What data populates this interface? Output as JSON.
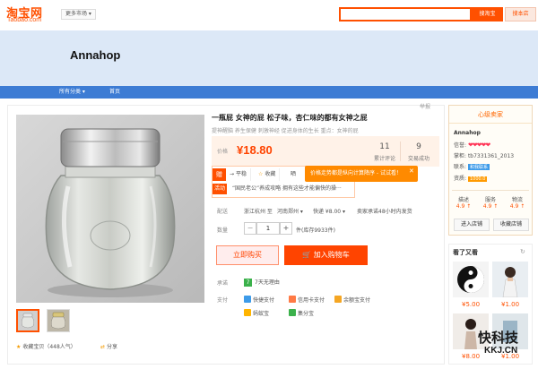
{
  "header": {
    "logo_cn": "淘宝网",
    "logo_en": "Taobao.com",
    "market_select": "更多市场 ▾",
    "search_button": "搜淘宝",
    "search_shop_button": "搜本店",
    "accent_color": "#ff5000"
  },
  "shop": {
    "name": "Annahop",
    "banner_color": "#dce8f7"
  },
  "nav": {
    "all_categories": "所有分类 ▾",
    "home": "首页",
    "bar_color": "#3d7cd4"
  },
  "item": {
    "report": "举报",
    "title": "一瓶屁 女神的屁 松子味，杏仁味的都有女神之屁",
    "subtitle": "提神醒脑 养生保健 刺激神经 促进身体的生长 重点：女神的屁",
    "price_label": "价格",
    "price": "¥18.80",
    "reviews_count": "11",
    "reviews_label": "累计评论",
    "deals_count": "9",
    "deals_label": "交易成功",
    "promo_badge": "赠",
    "actions": [
      "平稳",
      "收藏",
      "晒"
    ],
    "tooltip": "价格走势都是纵向计算降序 - 试试看！",
    "tooltip_close": "✕",
    "promo_tag": "活动",
    "promo_text": "“国民老公”养成攻略 拥有这些才能偏快的操···",
    "delivery_label": "配送",
    "delivery_from": "浙江杭州 至",
    "delivery_to": "河南郑州 ▾",
    "shipping": "快递 ¥8.00 ▾",
    "ship_promise": "卖家承诺48小时内发货",
    "qty_label": "数量",
    "qty_minus": "−",
    "qty_value": "1",
    "qty_plus": "+",
    "stock": "件(库存9933件)",
    "buy_now": "立即购买",
    "add_to_cart": "加入购物车",
    "promise_label": "承诺",
    "promise_badge": "7",
    "promise_text": "7天无理由",
    "pay_label": "支付",
    "pay_methods": [
      {
        "name": "快捷支付",
        "color": "#3d9be9"
      },
      {
        "name": "信用卡支付",
        "color": "#ff7a45"
      },
      {
        "name": "余额宝支付",
        "color": "#f5a623"
      },
      {
        "name": "蚂蚁宝",
        "color": "#ffb400"
      },
      {
        "name": "集分宝",
        "color": "#3bb14b"
      }
    ],
    "fav_label": "收藏宝贝（448人气）",
    "share_label": "分享"
  },
  "seller": {
    "header": "心级卖家",
    "name": "Annahop",
    "credit_label": "信誉:",
    "credit_hearts": "❤❤❤❤❤",
    "wangwang_label": "掌柜:",
    "wangwang": "tb7331361_2013",
    "contact_label": "联系:",
    "contact_badge": "和我联系",
    "qualification_label": "资质:",
    "deposit_badge": "1000.0",
    "scores": [
      {
        "label": "描述",
        "value": "4.9 ↑"
      },
      {
        "label": "服务",
        "value": "4.9 ↑"
      },
      {
        "label": "物流",
        "value": "4.9 ↑"
      }
    ],
    "enter_shop": "进入店铺",
    "favorite_shop": "收藏店铺"
  },
  "recent": {
    "title": "看了又看",
    "refresh": "↻",
    "items": [
      {
        "price": "¥5.00"
      },
      {
        "price": "¥1.00"
      },
      {
        "price": "¥8.00"
      },
      {
        "price": "¥1.00"
      }
    ]
  },
  "watermark": {
    "brand": "快科技",
    "url": "KKJ.CN"
  }
}
